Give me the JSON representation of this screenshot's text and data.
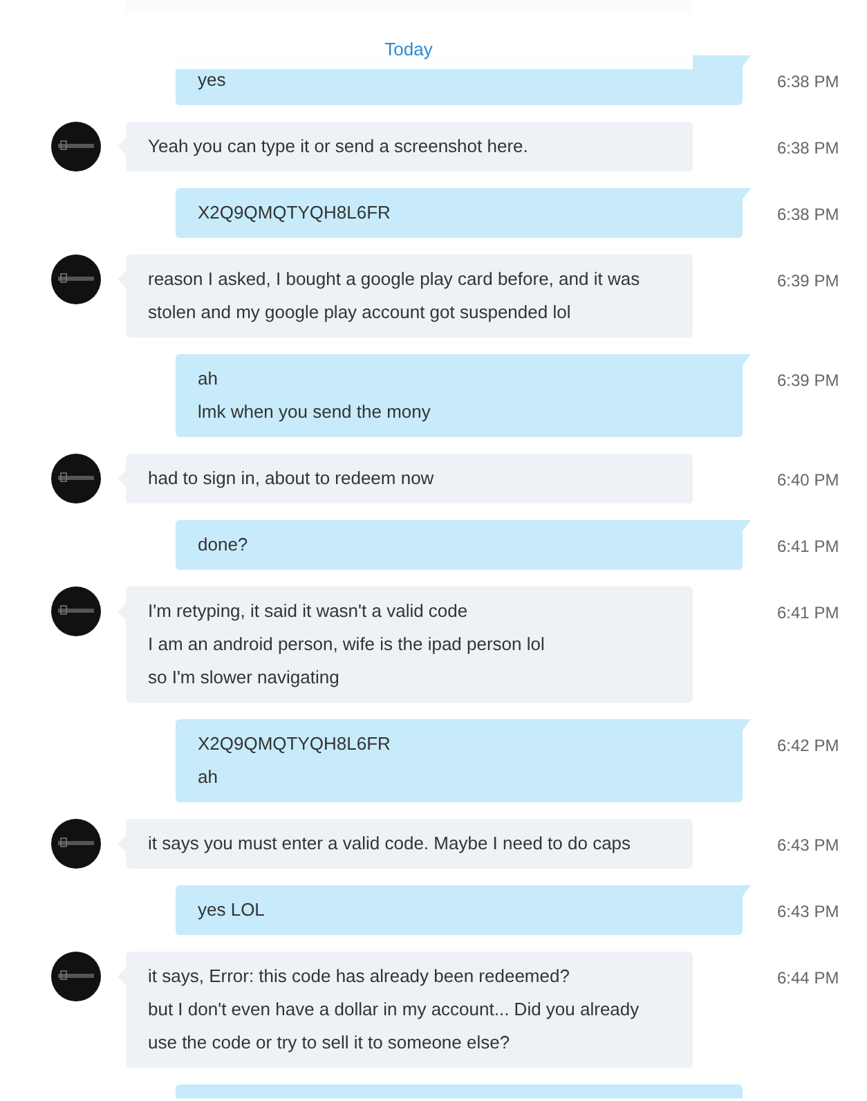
{
  "date_divider": "Today",
  "messages": [
    {
      "kind": "sent",
      "lines": [
        "yes"
      ],
      "time": "6:38 PM"
    },
    {
      "kind": "received",
      "lines": [
        "Yeah you can type it or send a screenshot here."
      ],
      "time": "6:38 PM"
    },
    {
      "kind": "sent",
      "lines": [
        "X2Q9QMQTYQH8L6FR"
      ],
      "time": "6:38 PM"
    },
    {
      "kind": "received",
      "lines": [
        "reason I asked, I bought a google play card before, and it was stolen and my google play account got suspended lol"
      ],
      "time": "6:39 PM"
    },
    {
      "kind": "sent",
      "lines": [
        "ah",
        "lmk when you send the mony"
      ],
      "time": "6:39 PM"
    },
    {
      "kind": "received",
      "lines": [
        "had to sign in, about to redeem now"
      ],
      "time": "6:40 PM"
    },
    {
      "kind": "sent",
      "lines": [
        "done?"
      ],
      "time": "6:41 PM"
    },
    {
      "kind": "received",
      "lines": [
        "I'm retyping, it said it wasn't a valid code",
        "I am an android person, wife is the ipad person lol",
        "so I'm slower navigating"
      ],
      "time": "6:41 PM"
    },
    {
      "kind": "sent",
      "lines": [
        "X2Q9QMQTYQH8L6FR",
        "ah"
      ],
      "time": "6:42 PM"
    },
    {
      "kind": "received",
      "lines": [
        "it says you must enter a valid code. Maybe I need to do caps"
      ],
      "time": "6:43 PM"
    },
    {
      "kind": "sent",
      "lines": [
        "yes LOL"
      ],
      "time": "6:43 PM"
    },
    {
      "kind": "received",
      "lines": [
        "it says, Error: this code has already been redeemed?",
        "but I don't even have a dollar in my account... Did you already use the code or try to sell it to someone else?"
      ],
      "time": "6:44 PM"
    }
  ],
  "trailing_bubble": {
    "kind": "sent"
  }
}
